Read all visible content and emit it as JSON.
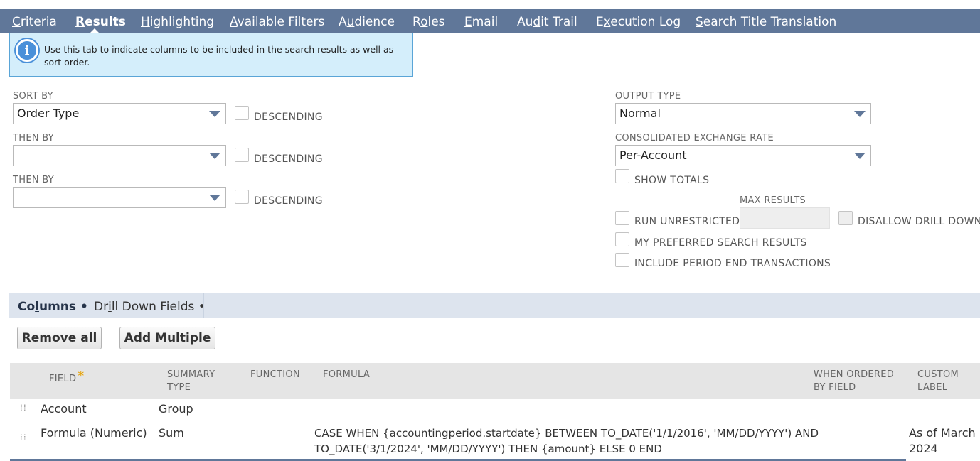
{
  "tabs": [
    {
      "pre": "",
      "u": "C",
      "post": "riteria",
      "active": false
    },
    {
      "pre": "",
      "u": "R",
      "post": "esults",
      "active": true
    },
    {
      "pre": "",
      "u": "H",
      "post": "ighlighting",
      "active": false
    },
    {
      "pre": "",
      "u": "A",
      "post": "vailable Filters",
      "active": false
    },
    {
      "pre": "A",
      "u": "u",
      "post": "dience",
      "active": false
    },
    {
      "pre": "R",
      "u": "o",
      "post": "les",
      "active": false
    },
    {
      "pre": "",
      "u": "E",
      "post": "mail",
      "active": false
    },
    {
      "pre": "Au",
      "u": "d",
      "post": "it Trail",
      "active": false
    },
    {
      "pre": "E",
      "u": "x",
      "post": "ecution Log",
      "active": false
    },
    {
      "pre": "",
      "u": "S",
      "post": "earch Title Translation",
      "active": false
    }
  ],
  "info": {
    "text": "Use this tab to indicate columns to be included in the search results as well as sort order."
  },
  "sort": {
    "sort_by_label": "SORT BY",
    "sort_by_value": "Order Type",
    "then_by_label_1": "THEN BY",
    "then_by_value_1": "",
    "then_by_label_2": "THEN BY",
    "then_by_value_2": "",
    "descending_label": "DESCENDING"
  },
  "output": {
    "output_type_label": "OUTPUT TYPE",
    "output_type_value": "Normal",
    "exchange_rate_label": "CONSOLIDATED EXCHANGE RATE",
    "exchange_rate_value": "Per-Account",
    "show_totals_label": "SHOW TOTALS",
    "max_results_label": "MAX RESULTS",
    "max_results_value": "",
    "run_unrestricted_label": "RUN UNRESTRICTED",
    "disallow_drill_down_label": "DISALLOW DRILL DOWN",
    "preferred_results_label": "MY PREFERRED SEARCH RESULTS",
    "period_end_label": "INCLUDE PERIOD END TRANSACTIONS"
  },
  "subtabs": {
    "columns": {
      "pre": "Co",
      "u": "l",
      "post": "umns •"
    },
    "drilldown": {
      "pre": "Dr",
      "u": "i",
      "post": "ll Down Fields •"
    }
  },
  "buttons": {
    "remove_all": "Remove all",
    "add_multiple": "Add Multiple"
  },
  "table": {
    "headers": {
      "field": "FIELD",
      "required_mark": "*",
      "summary_type_1": "SUMMARY",
      "summary_type_2": "TYPE",
      "function": "FUNCTION",
      "formula": "FORMULA",
      "when_ordered_1": "WHEN ORDERED",
      "when_ordered_2": "BY FIELD",
      "custom_label_1": "CUSTOM",
      "custom_label_2": "LABEL"
    },
    "rows": [
      {
        "field": "Account",
        "summary_type": "Group",
        "function": "",
        "formula_1": "",
        "formula_2": "",
        "when_ordered": "",
        "custom_label_1": "",
        "custom_label_2": ""
      },
      {
        "field": "Formula (Numeric)",
        "summary_type": "Sum",
        "function": "",
        "formula_1": "CASE WHEN {accountingperiod.startdate} BETWEEN TO_DATE('1/1/2016', 'MM/DD/YYYY') AND",
        "formula_2": "TO_DATE('3/1/2024', 'MM/DD/YYYY') THEN {amount} ELSE 0 END",
        "when_ordered": "",
        "custom_label_1": "As of March",
        "custom_label_2": "2024"
      }
    ]
  },
  "colors": {
    "tabbar": "#607799",
    "info_bg": "#d4eefb",
    "subtab_bg": "#dde4ee",
    "required": "#e6a100"
  }
}
